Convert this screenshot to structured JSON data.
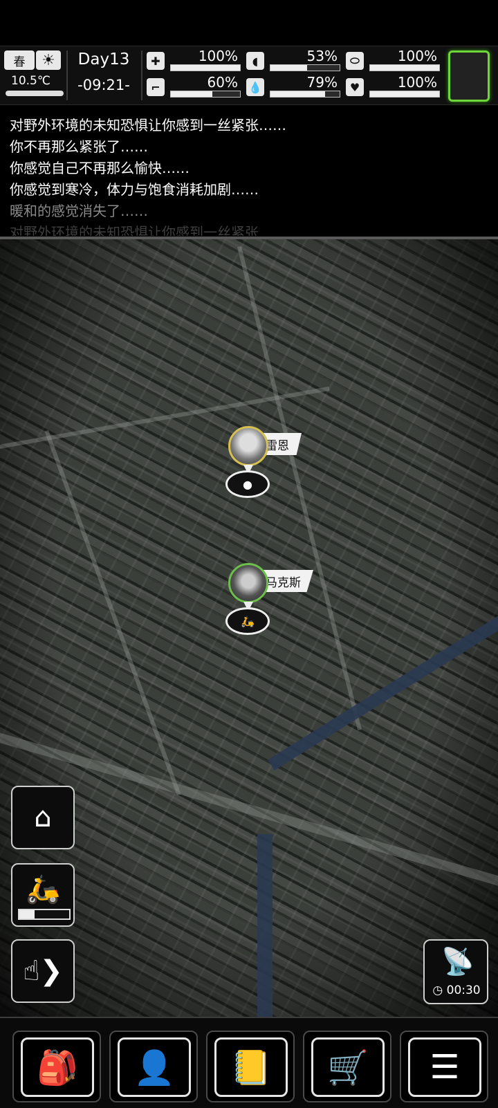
{
  "status": {
    "season": "春",
    "weather_icon": "sun-icon",
    "temperature": "10.5℃",
    "day": "Day13",
    "time": "-09:21-",
    "stats": [
      {
        "name": "health",
        "icon": "medkit-icon",
        "value_text": "100%",
        "value": 1.0
      },
      {
        "name": "hunger",
        "icon": "stomach-icon",
        "value_text": "53%",
        "value": 0.53
      },
      {
        "name": "mood",
        "icon": "pill-icon",
        "value_text": "100%",
        "value": 1.0
      },
      {
        "name": "stamina",
        "icon": "boot-icon",
        "value_text": "60%",
        "value": 0.6
      },
      {
        "name": "thirst",
        "icon": "water-drop-icon",
        "value_text": "79%",
        "value": 0.79
      },
      {
        "name": "spirit",
        "icon": "heart-icon",
        "value_text": "100%",
        "value": 1.0
      }
    ]
  },
  "log": {
    "lines": [
      "对野外环境的未知恐惧让你感到一丝紧张……",
      "你不再那么紧张了……",
      "你感觉自己不再那么愉快……",
      "你感觉到寒冷，体力与饱食消耗加剧……",
      "暖和的感觉消失了……",
      "对野外环境的未知恐惧让你感到一丝紧张"
    ]
  },
  "map": {
    "markers": [
      {
        "name": "雷恩",
        "base_icon": "pin-icon"
      },
      {
        "name": "马克斯",
        "base_icon": "scooter-icon"
      }
    ]
  },
  "controls": {
    "home_icon": "home-pin-icon",
    "scooter_icon": "scooter-icon",
    "scooter_fuel": 0.3,
    "interact_icon": "tap-hand-icon",
    "radar_icon": "satellite-dish-icon",
    "radar_timer": "00:30"
  },
  "bottom_nav": [
    "backpack-icon",
    "brain-icon",
    "notebook-icon",
    "shopping-cart-icon",
    "menu-list-icon"
  ]
}
